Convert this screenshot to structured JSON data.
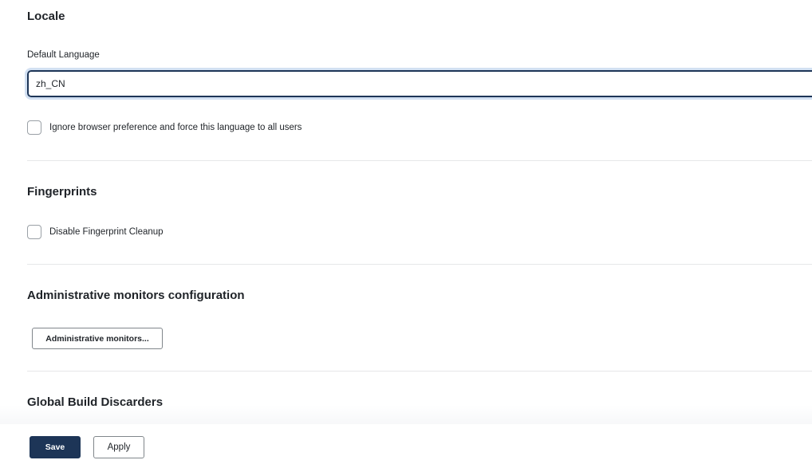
{
  "locale": {
    "title": "Locale",
    "default_language_label": "Default Language",
    "default_language_value": "zh_CN",
    "ignore_browser_label": "Ignore browser preference and force this language to all users",
    "ignore_browser_checked": false
  },
  "fingerprints": {
    "title": "Fingerprints",
    "disable_cleanup_label": "Disable Fingerprint Cleanup",
    "disable_cleanup_checked": false
  },
  "admin_monitors": {
    "title": "Administrative monitors configuration",
    "button_label": "Administrative monitors..."
  },
  "global_build_discarders": {
    "title": "Global Build Discarders"
  },
  "footer": {
    "save_label": "Save",
    "apply_label": "Apply"
  },
  "colors": {
    "primary": "#1d3557",
    "divider": "#e6e7e9",
    "checkbox_border": "#9aa0a6"
  }
}
